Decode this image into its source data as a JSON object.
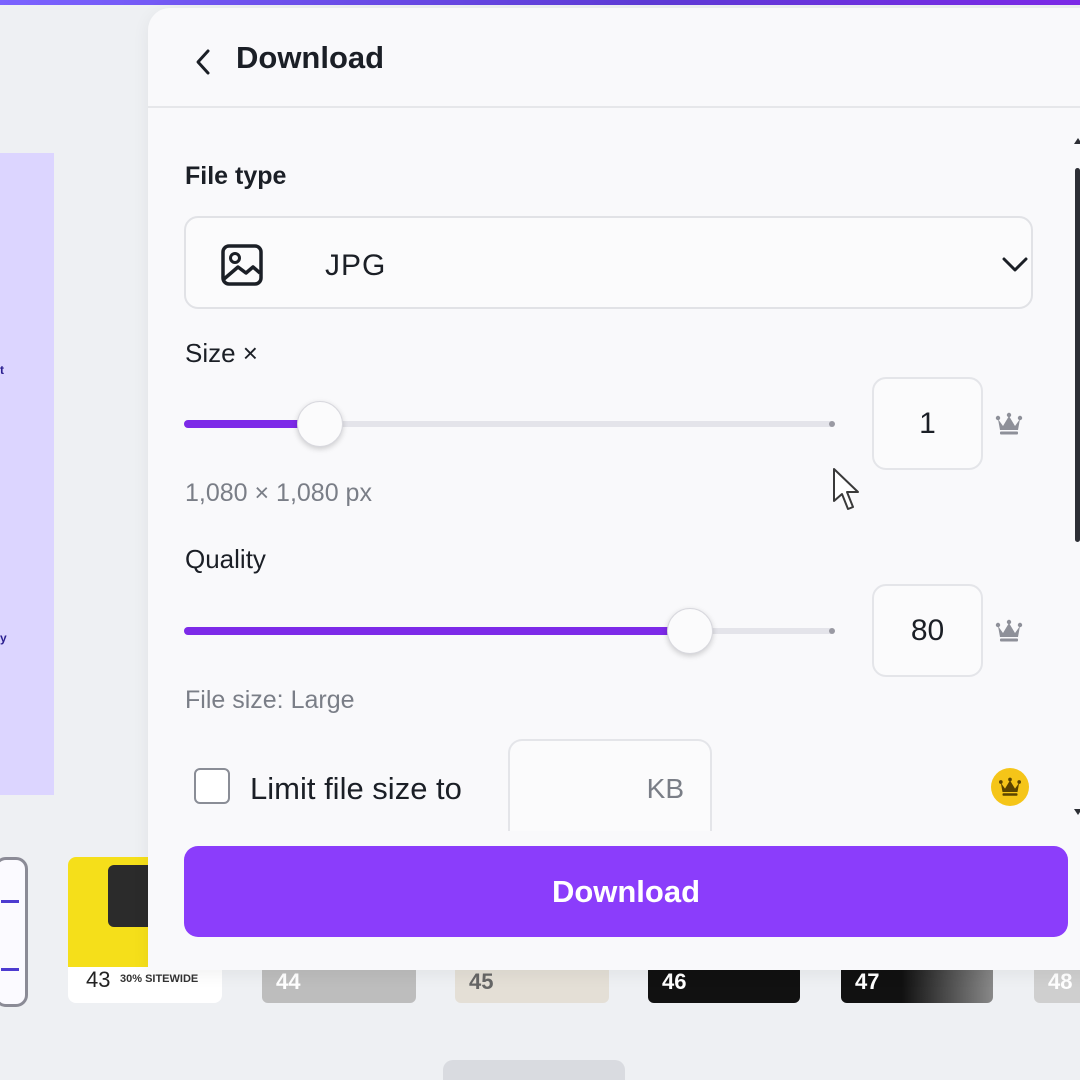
{
  "header": {
    "title": "Download",
    "back_icon": "chevron-left-icon"
  },
  "file_type": {
    "label": "File type",
    "selected": "JPG",
    "icon": "image-icon",
    "dropdown_icon": "chevron-down-icon"
  },
  "size": {
    "label": "Size ×",
    "value": "1",
    "slider_fraction": 0.21,
    "dimensions": "1,080 × 1,080 px",
    "pro_icon": "crown-icon"
  },
  "quality": {
    "label": "Quality",
    "value": "80",
    "slider_fraction": 0.78,
    "file_size": "File size: Large",
    "pro_icon": "crown-icon"
  },
  "limit": {
    "label": "Limit file size to",
    "value": "",
    "unit": "KB",
    "checked": false,
    "pro_badge_icon": "crown-icon"
  },
  "footer": {
    "download_label": "Download"
  },
  "thumbnails": {
    "numbers": [
      "43",
      "44",
      "45",
      "46",
      "47",
      "48"
    ],
    "thumb43_text": "30% SITEWIDE"
  },
  "colors": {
    "accent": "#7d2ae8",
    "button": "#8b3dfb",
    "crown_gold": "#f5c518"
  }
}
